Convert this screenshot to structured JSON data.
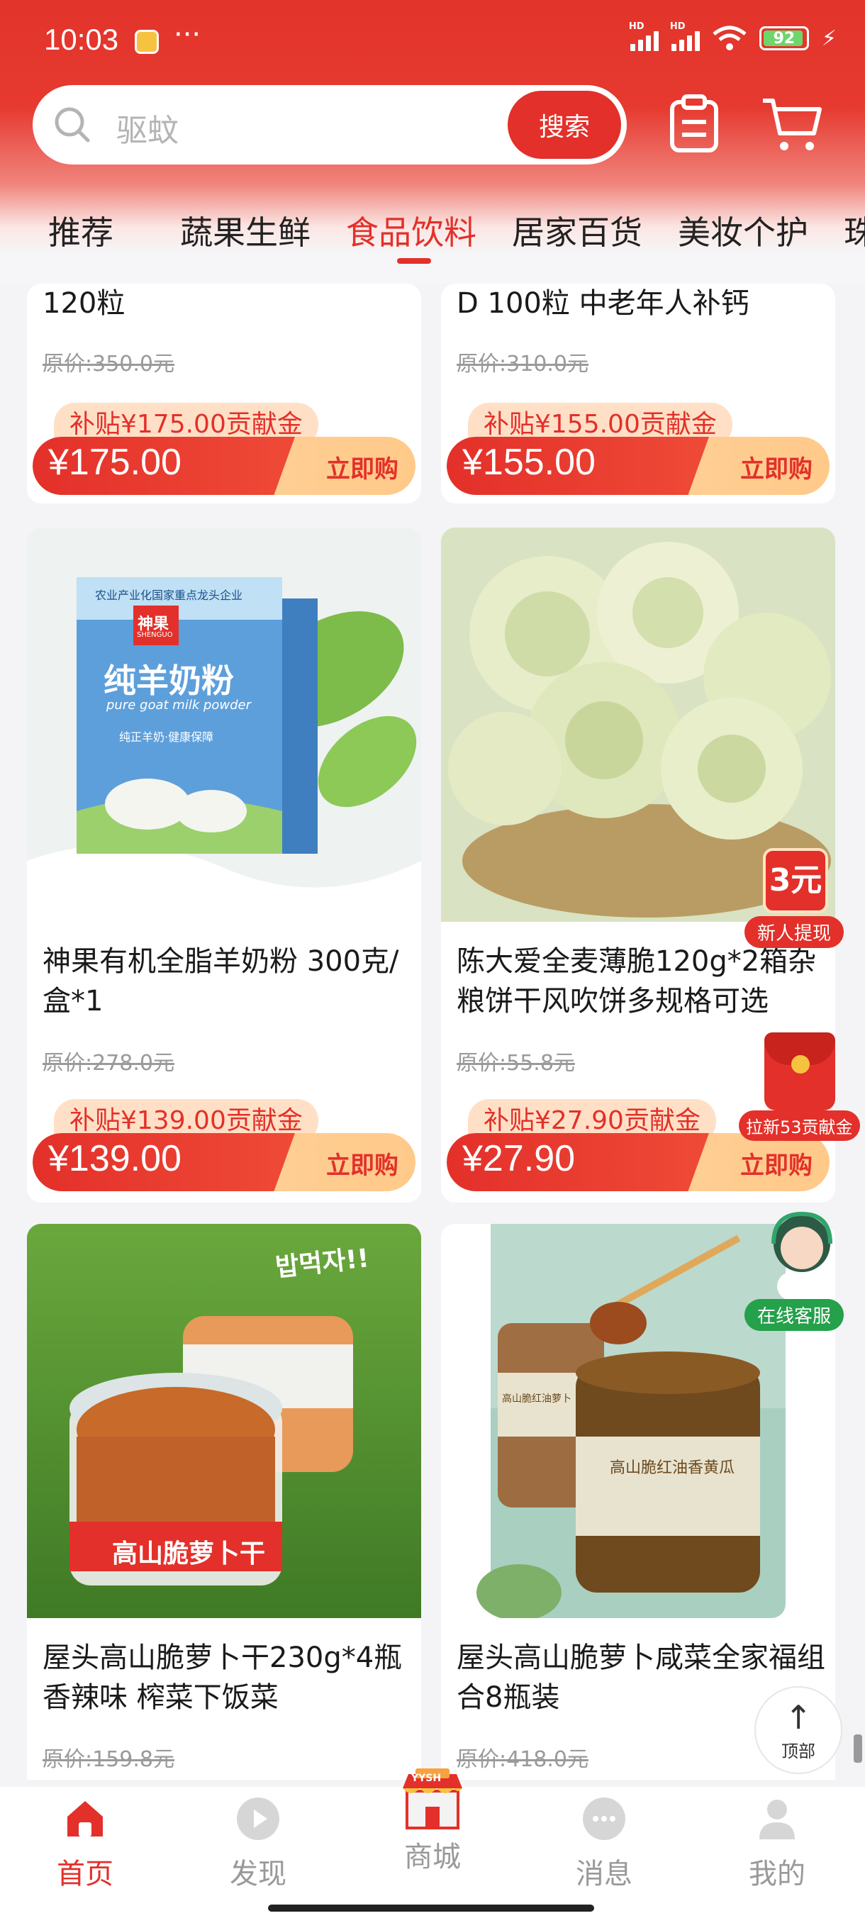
{
  "status_bar": {
    "time": "10:03",
    "battery": "92",
    "dots": "···"
  },
  "search": {
    "placeholder": "驱蚊",
    "button": "搜索"
  },
  "categories": [
    {
      "label": "推荐"
    },
    {
      "label": "蔬果生鲜"
    },
    {
      "label": "食品饮料",
      "active": true
    },
    {
      "label": "居家百货"
    },
    {
      "label": "美妆个护"
    },
    {
      "label": "珠"
    }
  ],
  "products": [
    {
      "title": "120粒",
      "original_price": "原价:350.0元",
      "subsidy": "补贴¥175.00贡献金",
      "price": "¥175.00",
      "buy": "立即购"
    },
    {
      "title": "D 100粒 中老年人补钙",
      "original_price": "原价:310.0元",
      "subsidy": "补贴¥155.00贡献金",
      "price": "¥155.00",
      "buy": "立即购"
    },
    {
      "title": "神果有机全脂羊奶粉 300克/盒*1",
      "original_price": "原价:278.0元",
      "subsidy": "补贴¥139.00贡献金",
      "price": "¥139.00",
      "buy": "立即购",
      "image_text": {
        "band": "农业产业化国家重点龙头企业",
        "brand": "神果",
        "brand_en": "SHENGUO",
        "name": "纯羊奶粉",
        "name_en": "pure goat milk powder",
        "tagline": "纯正羊奶·健康保障"
      }
    },
    {
      "title": "陈大爱全麦薄脆120g*2箱杂粮饼干风吹饼多规格可选",
      "original_price": "原价:55.8元",
      "subsidy": "补贴¥27.90贡献金",
      "price": "¥27.90",
      "buy": "立即购"
    },
    {
      "title": "屋头高山脆萝卜干230g*4瓶香辣味 榨菜下饭菜",
      "original_price": "原价:159.8元",
      "image_text": {
        "korean": "밥먹자!!",
        "jar": "高山脆萝卜干"
      }
    },
    {
      "title": "屋头高山脆萝卜咸菜全家福组合8瓶装",
      "original_price": "原价:418.0元",
      "image_text": {
        "jar1": "高山脆红油萝卜",
        "jar2": "高山脆红油香黄瓜"
      }
    }
  ],
  "floating": {
    "new_user_amount": "3元",
    "new_user_label": "新人提现",
    "invite_label": "拉新53贡献金",
    "service_label": "在线客服",
    "to_top": "顶部"
  },
  "bottom_nav": [
    {
      "label": "首页",
      "active": true
    },
    {
      "label": "发现"
    },
    {
      "label": "商城",
      "badge": "YYSH"
    },
    {
      "label": "消息"
    },
    {
      "label": "我的"
    }
  ],
  "colors": {
    "accent": "#e3302a",
    "subsidy_bg": "#ffe0c6",
    "buy_bg": "#ffc989",
    "service_green": "#25a04b"
  }
}
